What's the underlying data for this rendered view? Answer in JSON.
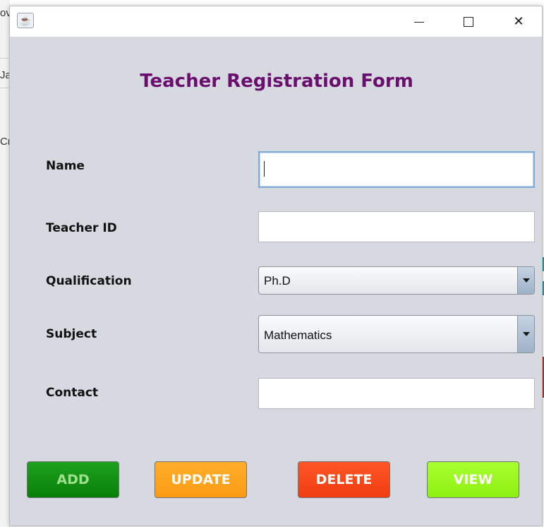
{
  "background": {
    "fragments": [
      "ove",
      "Ja",
      "Cr"
    ]
  },
  "window": {
    "app_icon": "java-cup-icon",
    "controls": {
      "minimize": "minimize-icon",
      "maximize": "maximize-icon",
      "close": "✕"
    }
  },
  "form": {
    "title": "Teacher Registration Form",
    "fields": {
      "name": {
        "label": "Name",
        "value": ""
      },
      "teacher_id": {
        "label": "Teacher ID",
        "value": ""
      },
      "qualification": {
        "label": "Qualification",
        "value": "Ph.D"
      },
      "subject": {
        "label": "Subject",
        "value": "Mathematics"
      },
      "contact": {
        "label": "Contact",
        "value": ""
      }
    },
    "buttons": {
      "add": "ADD",
      "update": "UPDATE",
      "delete": "DELETE",
      "view": "VIEW"
    }
  },
  "colors": {
    "title": "#6b0f6e",
    "add": "#0a8a0a",
    "update": "#fca41f",
    "delete": "#f84a1a",
    "view": "#9ef521",
    "panel": "#d6d9df"
  }
}
